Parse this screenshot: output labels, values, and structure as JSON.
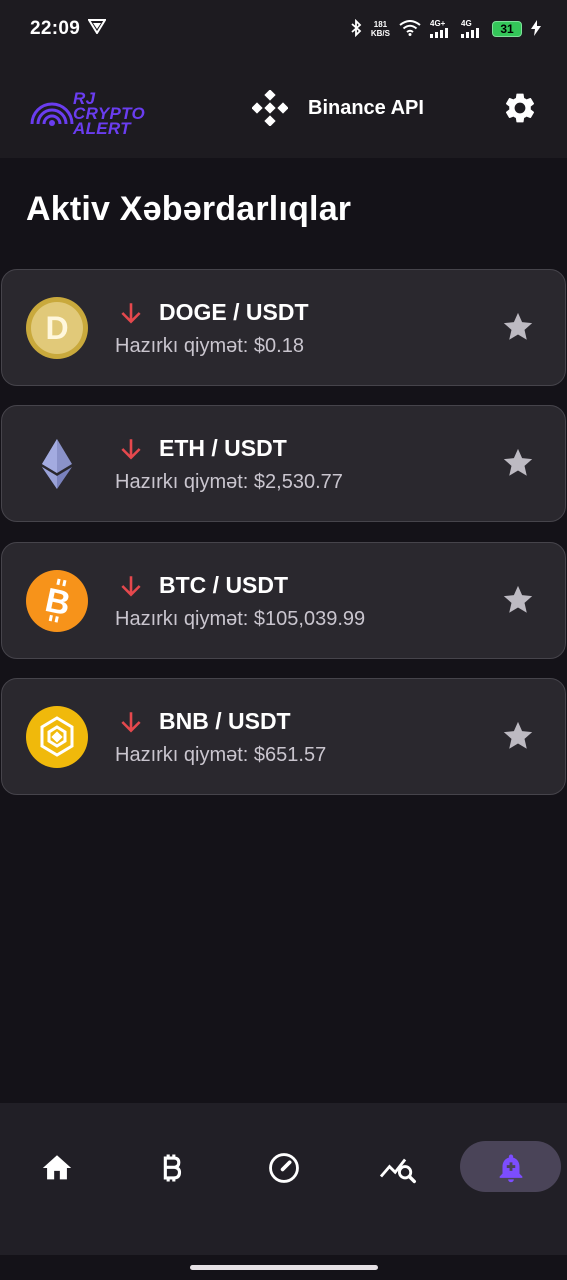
{
  "status_bar": {
    "time": "22:09",
    "net_speed_value": "181",
    "net_speed_unit": "KB/S",
    "signal1_label": "4G+",
    "signal2_label": "4G",
    "battery": "31"
  },
  "app_bar": {
    "logo_line1": "RJ CRYPTO",
    "logo_line2": "ALERT",
    "api_label": "Binance API",
    "accent_color": "#6a3df0"
  },
  "page": {
    "title": "Aktiv Xəbərdarlıqlar"
  },
  "alerts": [
    {
      "coin_icon": "doge-coin-icon",
      "pair": "DOGE / USDT",
      "price": "Hazırkı qiymət: $0.18",
      "direction": "down",
      "direction_color": "#e5484d"
    },
    {
      "coin_icon": "eth-coin-icon",
      "pair": "ETH / USDT",
      "price": "Hazırkı qiymət: $2,530.77",
      "direction": "down",
      "direction_color": "#e5484d"
    },
    {
      "coin_icon": "btc-coin-icon",
      "pair": "BTC / USDT",
      "price": "Hazırkı qiymət: $105,039.99",
      "direction": "down",
      "direction_color": "#e5484d"
    },
    {
      "coin_icon": "bnb-coin-icon",
      "pair": "BNB / USDT",
      "price": "Hazırkı qiymət: $651.57",
      "direction": "down",
      "direction_color": "#e5484d"
    }
  ],
  "bottom_nav": {
    "items": [
      {
        "icon": "home-icon"
      },
      {
        "icon": "bitcoin-icon"
      },
      {
        "icon": "gauge-icon"
      },
      {
        "icon": "chart-search-icon"
      },
      {
        "icon": "bell-add-icon",
        "active": true
      }
    ]
  }
}
